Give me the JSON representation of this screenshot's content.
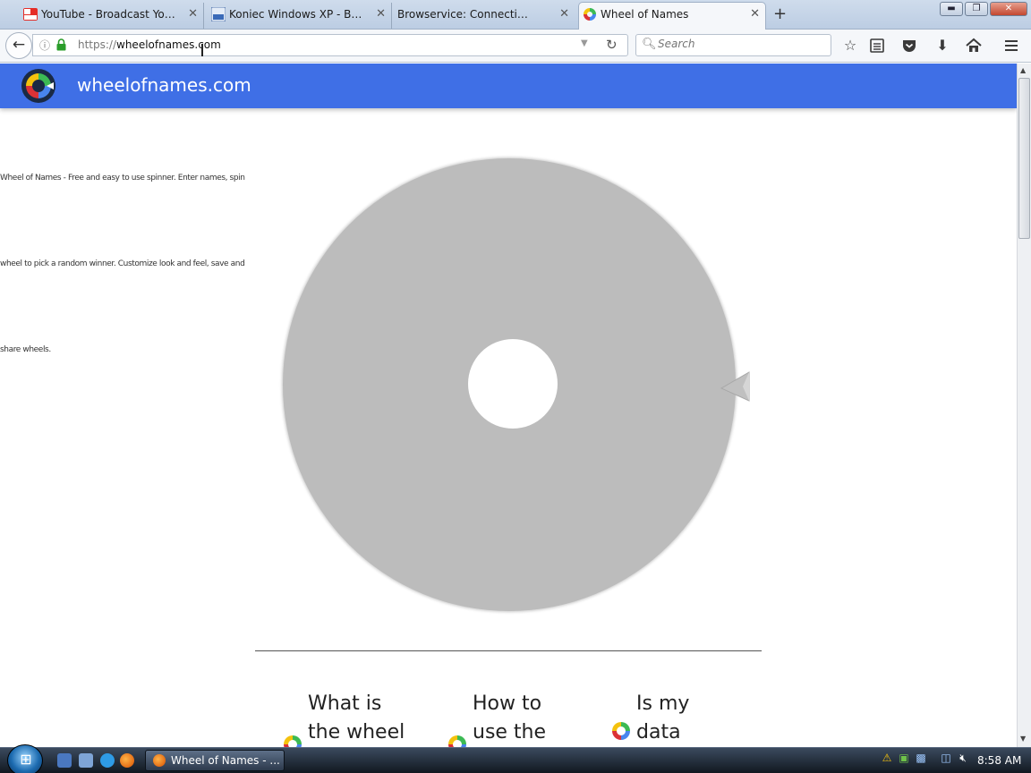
{
  "browser": {
    "tabs": [
      {
        "label": "YouTube - Broadcast Your...",
        "icon": "youtube-icon",
        "active": false
      },
      {
        "label": "Koniec Windows XP - BitVi...",
        "icon": "bitvice-icon",
        "active": false
      },
      {
        "label": "Browservice: Connection lost",
        "icon": "none",
        "active": false
      },
      {
        "label": "Wheel of Names",
        "icon": "wheel-of-names-icon",
        "active": true
      }
    ],
    "tab_close_glyph": "✕",
    "new_tab_glyph": "+",
    "url_protocol": "https://",
    "url_host": "wheelofnames.com",
    "search_placeholder": "Search",
    "window_controls": {
      "minimize": "▬",
      "restore": "❐",
      "close": "✕"
    }
  },
  "page": {
    "site_title": "wheelofnames.com",
    "description_lines": [
      "Wheel of Names - Free and easy to use spinner. Enter names, spin",
      "wheel to pick a random winner. Customize look and feel, save and",
      "share wheels."
    ],
    "faq_items": [
      {
        "line1": "What is",
        "line2": "the wheel"
      },
      {
        "line1": "How to",
        "line2": "use the"
      },
      {
        "line1": "Is my",
        "line2": "data"
      }
    ],
    "colors": {
      "header_blue": "#3f6fe6",
      "wheel_gray": "#bcbcbc",
      "logo_red": "#db3236",
      "logo_yellow": "#f4c20d",
      "logo_green": "#3cba54",
      "logo_blue": "#4885ed"
    }
  },
  "taskbar": {
    "active_window": "Wheel of Names - ...",
    "clock": "8:58 AM"
  }
}
